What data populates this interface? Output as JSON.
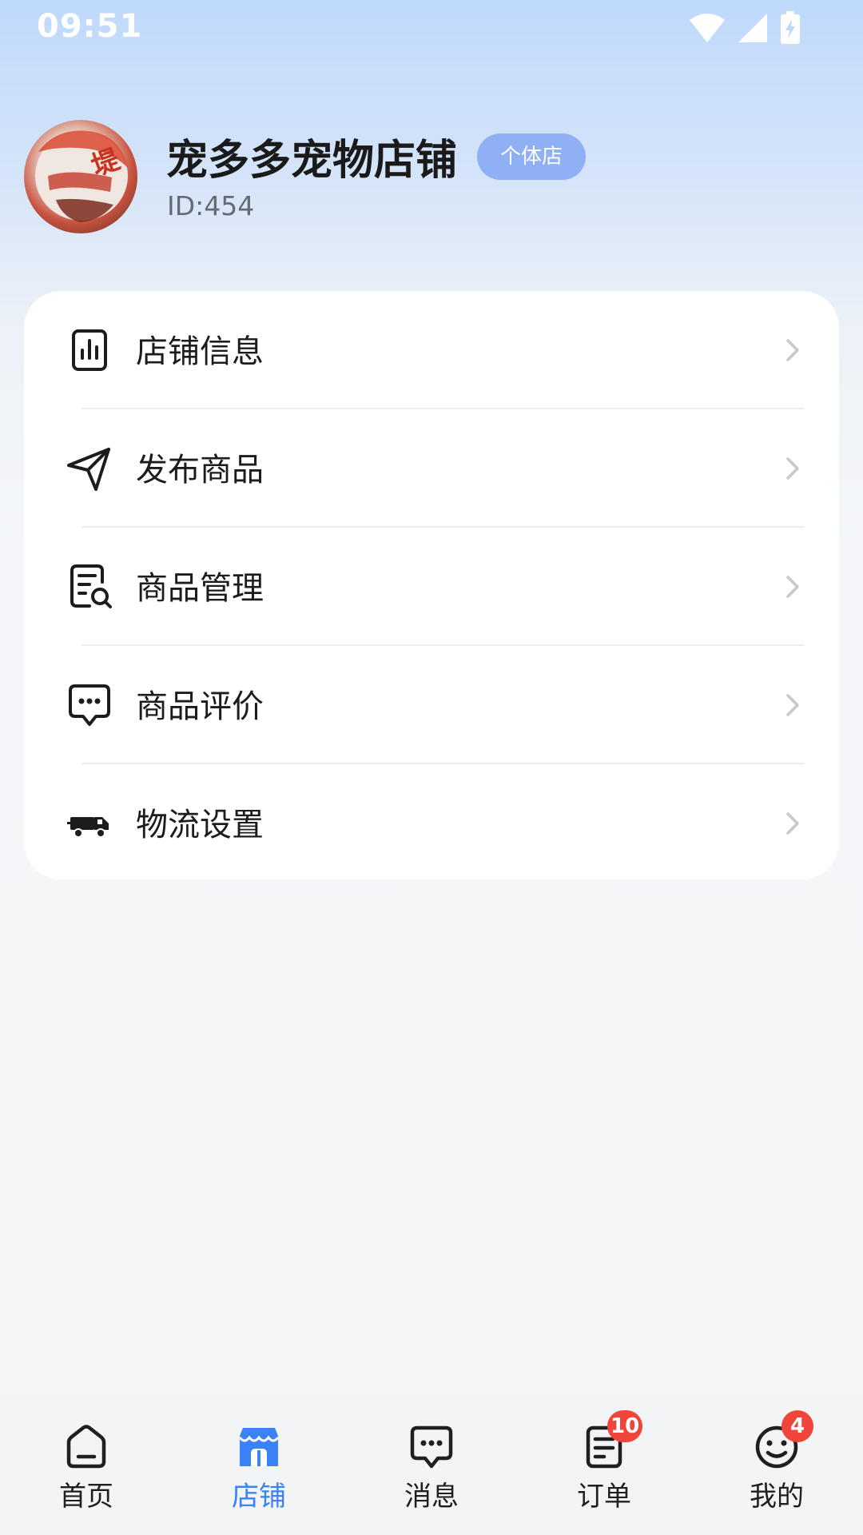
{
  "status_bar": {
    "time": "09:51",
    "icons": [
      "wifi-icon",
      "signal-icon",
      "battery-charging-icon"
    ]
  },
  "shop": {
    "name": "宠多多宠物店铺",
    "badge": "个体店",
    "id_text": "ID:454"
  },
  "menu": {
    "items": [
      {
        "label": "店铺信息",
        "icon": "bar-chart-icon"
      },
      {
        "label": "发布商品",
        "icon": "send-icon"
      },
      {
        "label": "商品管理",
        "icon": "document-search-icon"
      },
      {
        "label": "商品评价",
        "icon": "chat-bubble-icon"
      },
      {
        "label": "物流设置",
        "icon": "truck-icon"
      }
    ]
  },
  "bottom_nav": {
    "items": [
      {
        "label": "首页",
        "icon": "home-icon",
        "active": false
      },
      {
        "label": "店铺",
        "icon": "store-icon",
        "active": true
      },
      {
        "label": "消息",
        "icon": "message-icon",
        "active": false
      },
      {
        "label": "订单",
        "icon": "order-icon",
        "active": false,
        "badge": "10"
      },
      {
        "label": "我的",
        "icon": "smile-icon",
        "active": false,
        "badge": "4"
      }
    ]
  },
  "colors": {
    "accent": "#3b82f6",
    "badge_bg": "#f0453a",
    "shop_badge_bg": "#8fb0f4"
  }
}
